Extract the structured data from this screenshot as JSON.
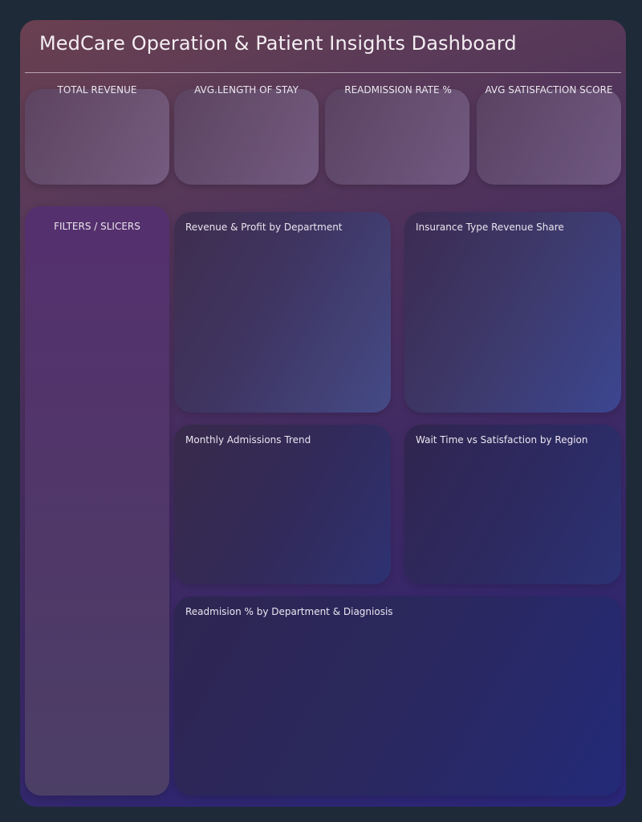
{
  "dashboard": {
    "title": "MedCare Operation & Patient Insights Dashboard"
  },
  "kpis": [
    {
      "label": "TOTAL REVENUE"
    },
    {
      "label": "AVG.LENGTH OF STAY"
    },
    {
      "label": "READMISSION RATE %"
    },
    {
      "label": "AVG SATISFACTION SCORE"
    }
  ],
  "filters": {
    "label": "FILTERS / SLICERS"
  },
  "charts": [
    {
      "title": "Revenue & Profit by Department"
    },
    {
      "title": "Insurance Type Revenue Share"
    },
    {
      "title": "Monthly Admissions Trend"
    },
    {
      "title": "Wait Time vs Satisfaction by Region"
    },
    {
      "title": "Readmision % by Department & Diagniosis"
    }
  ]
}
